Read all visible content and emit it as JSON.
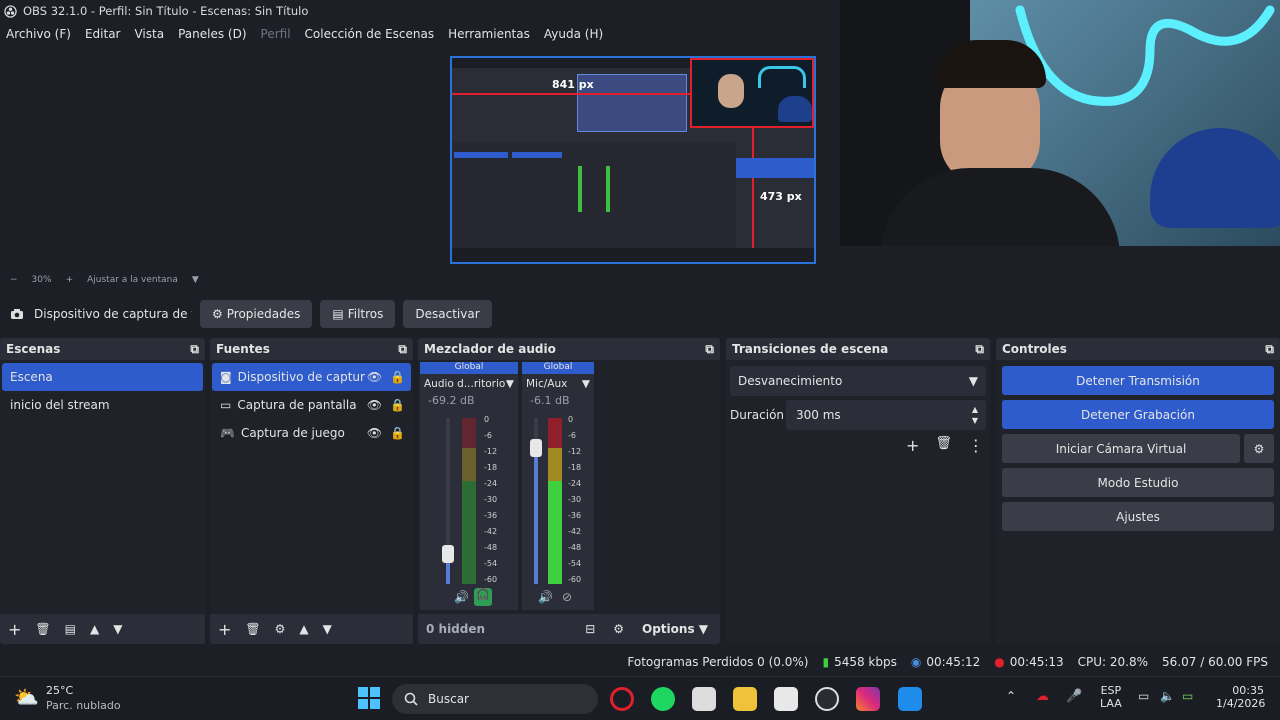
{
  "window": {
    "title": "OBS 32.1.0 - Perfil: Sin Título - Escenas: Sin Título"
  },
  "menu": {
    "items": [
      "Archivo (F)",
      "Editar",
      "Vista",
      "Paneles (D)",
      "Perfil",
      "Colección de Escenas",
      "Herramientas",
      "Ayuda (H)"
    ]
  },
  "preview": {
    "dim_h": "841 px",
    "dim_v": "473 px",
    "zoom": "30%",
    "fit_label": "Ajustar a la ventana"
  },
  "context": {
    "source_label": "Dispositivo de captura de v",
    "properties": "Propiedades",
    "filters": "Filtros",
    "deactivate": "Desactivar"
  },
  "scenes": {
    "title": "Escenas",
    "items": [
      "Escena",
      "inicio del stream"
    ]
  },
  "sources": {
    "title": "Fuentes",
    "items": [
      "Dispositivo de captur",
      "Captura de pantalla",
      "Captura de juego"
    ]
  },
  "mixer": {
    "title": "Mezclador de audio",
    "channels": [
      {
        "badge": "Global",
        "name": "Audio d...ritorio",
        "db": "-69.2 dB",
        "level": 0.18
      },
      {
        "badge": "Global",
        "name": "Mic/Aux",
        "db": "-6.1 dB",
        "level": 0.82
      }
    ],
    "scale": [
      "0",
      "-6",
      "-12",
      "-18",
      "-24",
      "-30",
      "-36",
      "-42",
      "-48",
      "-54",
      "-60"
    ],
    "hidden": "0 hidden",
    "options": "Options"
  },
  "transitions": {
    "title": "Transiciones de escena",
    "selected": "Desvanecimiento",
    "duration_label": "Duración",
    "duration_value": "300 ms"
  },
  "controls": {
    "title": "Controles",
    "stop_stream": "Detener Transmisión",
    "stop_record": "Detener Grabación",
    "virtual_cam": "Iniciar Cámara Virtual",
    "studio_mode": "Modo Estudio",
    "settings": "Ajustes"
  },
  "status": {
    "dropped": "Fotogramas Perdidos 0 (0.0%)",
    "bitrate": "5458 kbps",
    "stream_time": "00:45:12",
    "rec_time": "00:45:13",
    "cpu": "CPU: 20.8%",
    "fps": "56.07 / 60.00 FPS"
  },
  "taskbar": {
    "temp": "25°C",
    "weather": "Parc. nublado",
    "search": "Buscar",
    "lang1": "ESP",
    "lang2": "LAA",
    "time": "00:35",
    "date": "1/4/2026"
  },
  "colors": {
    "accent": "#2f5ccc",
    "panel": "#2b2e38",
    "background": "#1d1f26",
    "selection_red": "#e0202a"
  }
}
